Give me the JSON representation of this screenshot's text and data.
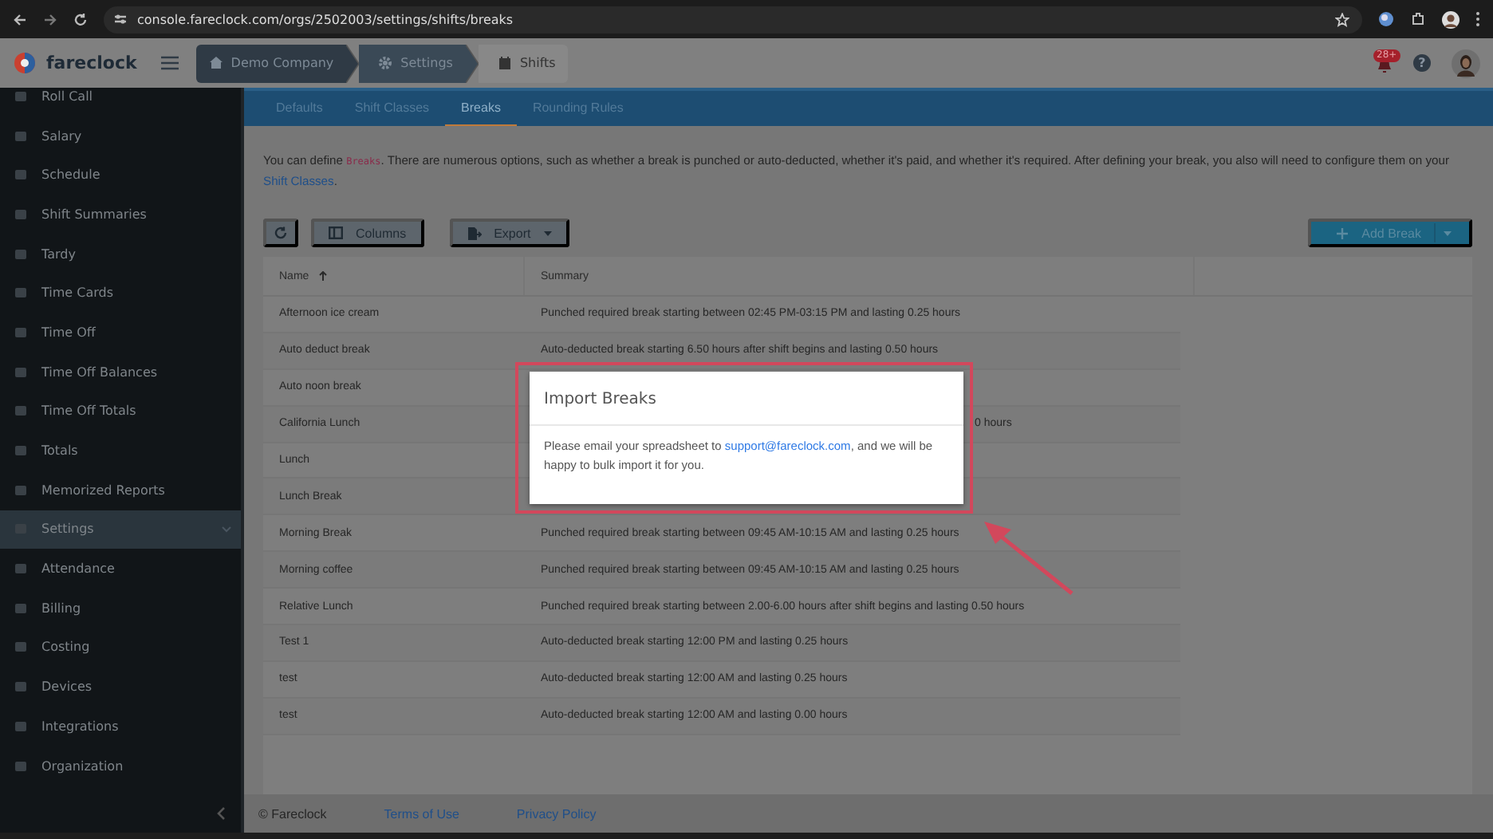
{
  "browser": {
    "url": "console.fareclock.com/orgs/2502003/settings/shifts/breaks"
  },
  "header": {
    "logo": "fareclock",
    "breadcrumb": [
      {
        "label": "Demo Company",
        "kind": "home"
      },
      {
        "label": "Settings",
        "kind": "gear"
      },
      {
        "label": "Shifts",
        "kind": "calendar"
      }
    ],
    "notification_badge": "28+",
    "help": "?"
  },
  "sidebar": {
    "items": [
      {
        "label": "Roll Call",
        "selected": false
      },
      {
        "label": "Salary",
        "selected": false
      },
      {
        "label": "Schedule",
        "selected": false
      },
      {
        "label": "Shift Summaries",
        "selected": false
      },
      {
        "label": "Tardy",
        "selected": false
      },
      {
        "label": "Time Cards",
        "selected": false
      },
      {
        "label": "Time Off",
        "selected": false
      },
      {
        "label": "Time Off Balances",
        "selected": false
      },
      {
        "label": "Time Off Totals",
        "selected": false
      },
      {
        "label": "Totals",
        "selected": false
      },
      {
        "label": "Memorized Reports",
        "selected": false
      },
      {
        "label": "Settings",
        "selected": true
      },
      {
        "label": "Attendance",
        "selected": false
      },
      {
        "label": "Billing",
        "selected": false
      },
      {
        "label": "Costing",
        "selected": false
      },
      {
        "label": "Devices",
        "selected": false
      },
      {
        "label": "Integrations",
        "selected": false
      },
      {
        "label": "Organization",
        "selected": false
      }
    ]
  },
  "tabs": [
    {
      "label": "Defaults",
      "selected": false
    },
    {
      "label": "Shift Classes",
      "selected": false
    },
    {
      "label": "Breaks",
      "selected": true
    },
    {
      "label": "Rounding Rules",
      "selected": false
    }
  ],
  "intro": {
    "before": "You can define ",
    "code": "Breaks",
    "middle": ". There are numerous options, such as whether a break is punched or auto-deducted, whether it's paid, and whether it's required. After defining your break, you also will need to configure them on your ",
    "link": "Shift Classes",
    "after": "."
  },
  "toolbar": [
    {
      "kind": "refresh"
    },
    {
      "kind": "columns",
      "label": "Columns"
    },
    {
      "kind": "export",
      "label": "Export"
    }
  ],
  "add_button": {
    "label": "Add Break"
  },
  "table": {
    "columns": [
      {
        "label": "Name",
        "sorted_ascending": true
      },
      {
        "label": "Summary"
      }
    ],
    "rows": [
      {
        "name": "Afternoon ice cream",
        "summary": "Punched required break starting between 02:45 PM-03:15 PM and lasting 0.25 hours"
      },
      {
        "name": "Auto deduct break",
        "summary": "Auto-deducted break starting 6.50 hours after shift begins and lasting 0.50 hours"
      },
      {
        "name": "Auto noon break"
      },
      {
        "name": "California Lunch",
        "summary_tail": "0 hours"
      },
      {
        "name": "Lunch"
      },
      {
        "name": "Lunch Break"
      },
      {
        "name": "Morning Break",
        "summary": "Punched required break starting between 09:45 AM-10:15 AM and lasting 0.25 hours"
      },
      {
        "name": "Morning coffee",
        "summary": "Punched required break starting between 09:45 AM-10:15 AM and lasting 0.25 hours"
      },
      {
        "name": "Relative Lunch",
        "summary": "Punched required break starting between 2.00-6.00 hours after shift begins and lasting 0.50 hours"
      },
      {
        "name": "Test 1",
        "summary": "Auto-deducted break starting 12:00 PM and lasting 0.25 hours"
      },
      {
        "name": "test",
        "summary": "Auto-deducted break starting 12:00 AM and lasting 0.25 hours"
      },
      {
        "name": "test",
        "summary": "Auto-deducted break starting 12:00 AM and lasting 0.00 hours"
      }
    ]
  },
  "modal": {
    "title": "Import Breaks",
    "before": "Please email your spreadsheet to ",
    "link": "support@fareclock.com",
    "after": ", and we will be happy to bulk import it for you."
  },
  "footer": [
    {
      "kind": "text",
      "label": "© Fareclock"
    },
    {
      "kind": "link",
      "label": "Terms of Use"
    },
    {
      "kind": "link",
      "label": "Privacy Policy"
    }
  ]
}
